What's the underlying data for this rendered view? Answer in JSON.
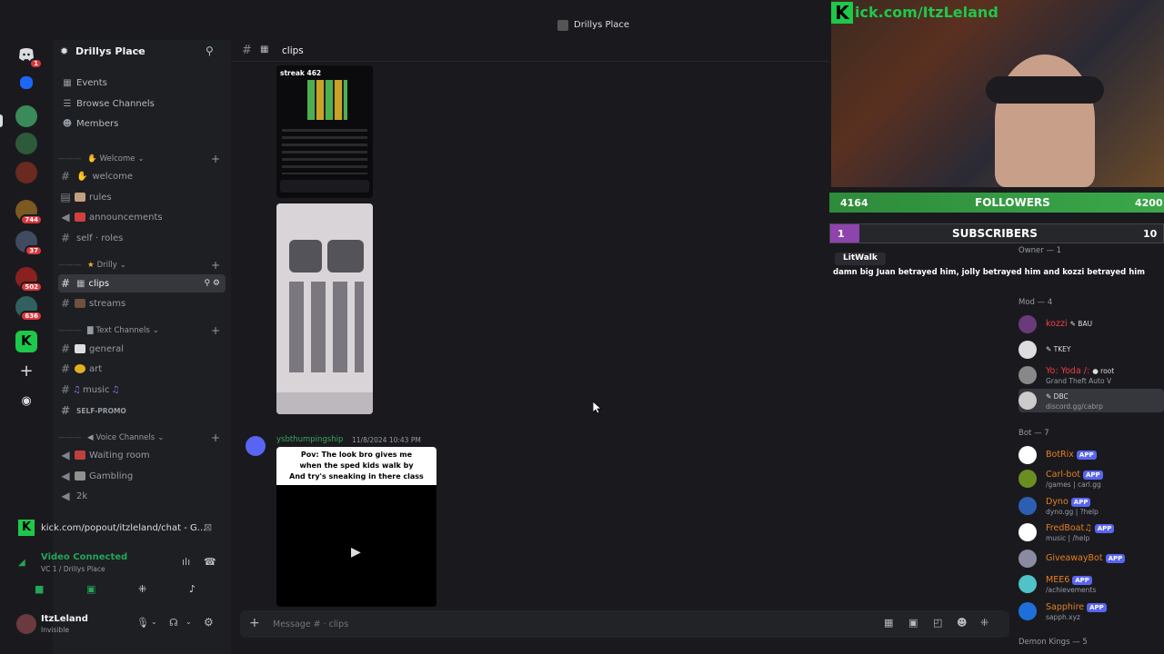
{
  "window": {
    "title": "Drillys Place"
  },
  "rail": {
    "badges": [
      "1",
      "744",
      "37",
      "502",
      "636"
    ]
  },
  "sidebar": {
    "guild_name": "Drillys Place",
    "nav": [
      {
        "label": "Events"
      },
      {
        "label": "Browse Channels"
      },
      {
        "label": "Members"
      }
    ],
    "categories": [
      {
        "name": "Welcome",
        "channels": [
          {
            "name": "welcome"
          },
          {
            "name": "rules"
          },
          {
            "name": "announcements"
          },
          {
            "name": "self · roles"
          }
        ]
      },
      {
        "name": "Drilly",
        "channels": [
          {
            "name": "clips"
          },
          {
            "name": "streams"
          }
        ]
      },
      {
        "name": "Text Channels",
        "channels": [
          {
            "name": "general"
          },
          {
            "name": "art"
          },
          {
            "name": "music"
          },
          {
            "name": "SELF-PROMO"
          }
        ]
      },
      {
        "name": "Voice Channels",
        "channels": [
          {
            "name": "Waiting room"
          },
          {
            "name": "Gambling"
          },
          {
            "name": "2k"
          }
        ]
      }
    ]
  },
  "voice": {
    "activity": "kick.com/popout/itzleland/chat - G...",
    "status": "Video Connected",
    "location": "VC 1 / Drillys Place"
  },
  "user": {
    "name": "ItzLeland",
    "status": "Invisible"
  },
  "channel": {
    "name": "clips"
  },
  "messages": [
    {
      "clip1_title": "streak 462"
    },
    {
      "author": "ysbthumpingship",
      "time": "11/8/2024 10:43 PM",
      "caption_line1": "Pov: The look bro gives me",
      "caption_line2": "when the sped kids walk by",
      "caption_line3": "And try's sneaking in there class"
    }
  ],
  "composer": {
    "placeholder": "Message # · clips"
  },
  "overlay": {
    "kick_url": "ick.com/ItzLeland",
    "followers_left": "4164",
    "followers_label": "FOLLOWERS",
    "followers_right": "4200",
    "subs_left": "1",
    "subs_label": "SUBSCRIBERS",
    "subs_right": "10",
    "chat_user": "LitWalk",
    "chat_text": "damn big Juan betrayed him, jolly betrayed him and kozzi betrayed him",
    "owner_group": "Owner — 1"
  },
  "members": {
    "mod_group": "Mod — 4",
    "mods": [
      {
        "name": "kozzi",
        "tag": "BAU",
        "color": "#f23f43"
      },
      {
        "name": "",
        "tag": "TKEY",
        "color": "#8e44ad"
      },
      {
        "name": "Yo: Yoda /:",
        "tag": "root",
        "sub": "Grand Theft Auto V",
        "color": "#f23f43"
      },
      {
        "name": "",
        "tag": "DBC",
        "sub": "discord.gg/cabrp",
        "color": "#8e44ad"
      }
    ],
    "bot_group": "Bot — 7",
    "bots": [
      {
        "name": "BotRix",
        "sub": "",
        "color": "#e67e22"
      },
      {
        "name": "Carl-bot",
        "sub": "/games | carl.gg",
        "color": "#e67e22"
      },
      {
        "name": "Dyno",
        "sub": "dyno.gg | ?help",
        "color": "#e67e22"
      },
      {
        "name": "FredBoat♫",
        "sub": "music | /help",
        "color": "#e67e22"
      },
      {
        "name": "GiveawayBot",
        "sub": "",
        "color": "#e67e22"
      },
      {
        "name": "MEE6",
        "sub": "/achievements",
        "color": "#e67e22"
      },
      {
        "name": "Sapphire",
        "sub": "sapph.xyz",
        "color": "#e67e22"
      }
    ],
    "app_label": "APP",
    "next_group": "Demon Kings — 5"
  }
}
